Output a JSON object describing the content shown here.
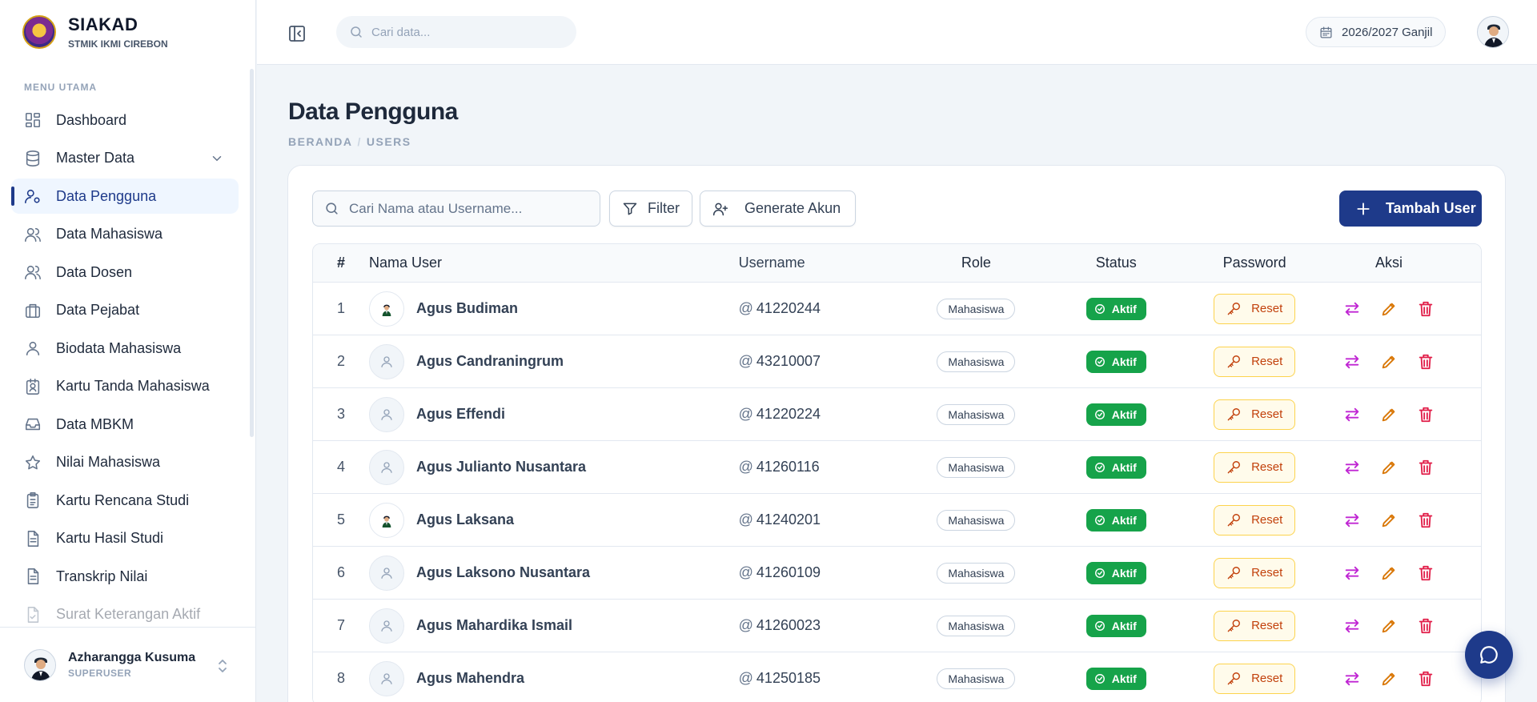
{
  "app": {
    "title": "SIAKAD",
    "subtitle": "STMIK IKMI CIREBON"
  },
  "sidebar": {
    "section_label": "MENU UTAMA",
    "items": [
      {
        "label": "Dashboard",
        "icon": "grid-icon"
      },
      {
        "label": "Master Data",
        "icon": "database-icon"
      },
      {
        "label": "Data Pengguna",
        "icon": "user-gear-icon",
        "active": true
      },
      {
        "label": "Data Mahasiswa",
        "icon": "users-icon"
      },
      {
        "label": "Data Dosen",
        "icon": "users-icon"
      },
      {
        "label": "Data Pejabat",
        "icon": "briefcase-icon"
      },
      {
        "label": "Biodata Mahasiswa",
        "icon": "user-icon"
      },
      {
        "label": "Kartu Tanda Mahasiswa",
        "icon": "id-card-icon"
      },
      {
        "label": "Data MBKM",
        "icon": "inbox-icon"
      },
      {
        "label": "Nilai Mahasiswa",
        "icon": "star-icon"
      },
      {
        "label": "Kartu Rencana Studi",
        "icon": "clipboard-icon"
      },
      {
        "label": "Kartu Hasil Studi",
        "icon": "document-icon"
      },
      {
        "label": "Transkrip Nilai",
        "icon": "document-icon"
      },
      {
        "label": "Surat Keterangan Aktif",
        "icon": "file-check-icon"
      }
    ],
    "user": {
      "name": "Azharangga Kusuma",
      "role": "SUPERUSER"
    }
  },
  "topbar": {
    "search_placeholder": "Cari data...",
    "semester": "2026/2027 Ganjil"
  },
  "page": {
    "title": "Data Pengguna",
    "breadcrumb": [
      "BERANDA",
      "USERS"
    ]
  },
  "toolbar": {
    "search_placeholder": "Cari Nama atau Username...",
    "filter_label": "Filter",
    "generate_label": "Generate Akun",
    "add_label": "Tambah User"
  },
  "table": {
    "headers": {
      "no": "#",
      "name": "Nama User",
      "username": "Username",
      "role": "Role",
      "status": "Status",
      "password": "Password",
      "actions": "Aksi"
    },
    "reset_label": "Reset",
    "rows": [
      {
        "no": "1",
        "name": "Agus Budiman",
        "username": "41220244",
        "role": "Mahasiswa",
        "status": "Aktif",
        "photo": true
      },
      {
        "no": "2",
        "name": "Agus Candraningrum",
        "username": "43210007",
        "role": "Mahasiswa",
        "status": "Aktif",
        "photo": false
      },
      {
        "no": "3",
        "name": "Agus Effendi",
        "username": "41220224",
        "role": "Mahasiswa",
        "status": "Aktif",
        "photo": false
      },
      {
        "no": "4",
        "name": "Agus Julianto Nusantara",
        "username": "41260116",
        "role": "Mahasiswa",
        "status": "Aktif",
        "photo": false
      },
      {
        "no": "5",
        "name": "Agus Laksana",
        "username": "41240201",
        "role": "Mahasiswa",
        "status": "Aktif",
        "photo": true
      },
      {
        "no": "6",
        "name": "Agus Laksono Nusantara",
        "username": "41260109",
        "role": "Mahasiswa",
        "status": "Aktif",
        "photo": false
      },
      {
        "no": "7",
        "name": "Agus Mahardika Ismail",
        "username": "41260023",
        "role": "Mahasiswa",
        "status": "Aktif",
        "photo": false
      },
      {
        "no": "8",
        "name": "Agus Mahendra",
        "username": "41250185",
        "role": "Mahasiswa",
        "status": "Aktif",
        "photo": false
      }
    ]
  },
  "colors": {
    "primary": "#1e3a8a",
    "success": "#16a34a",
    "warning": "#d97706",
    "danger": "#e11d48",
    "accent": "#c026d3"
  }
}
